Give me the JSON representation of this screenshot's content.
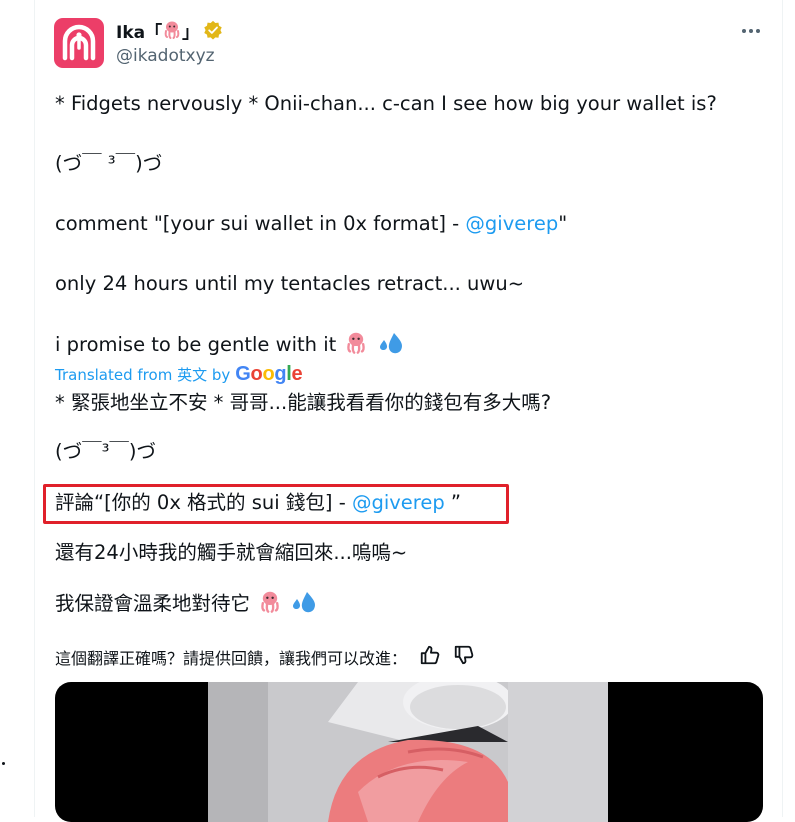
{
  "tweet": {
    "author": {
      "display_name": "Ika「",
      "display_name_suffix": "」",
      "handle": "@ikadotxyz",
      "verified": true,
      "avatar_color": "#ec3e68"
    },
    "more_label": "More",
    "original": {
      "line1": "* Fidgets nervously * Onii-chan... c-can I see how big your wallet is?",
      "line2": "(づ￣ ³￣)づ",
      "line3_pre": "comment \"[your sui wallet in 0x format] - ",
      "line3_mention": "@giverep",
      "line3_post": "\"",
      "line4": "only 24 hours until my tentacles retract... uwu~",
      "line5": "i promise to be gentle with it"
    },
    "translation_note": {
      "prefix": "Translated from 英文 by",
      "provider": "Google"
    },
    "translated": {
      "line1": "* 緊張地坐立不安 * 哥哥...能讓我看看你的錢包有多大嗎?",
      "line2": "(づ￣³￣)づ",
      "line3_pre": "評論“[你的 0x 格式的 sui 錢包] - ",
      "line3_mention": "@giverep",
      "line3_post": " ”",
      "line4": "還有24小時我的觸手就會縮回來...嗚嗚~",
      "line5": "我保證會溫柔地對待它"
    },
    "feedback": {
      "question": "這個翻譯正確嗎？請提供回饋，讓我們可以改進："
    }
  },
  "colors": {
    "link": "#1d9bf0",
    "secondary_text": "#536471",
    "highlight_border": "#e0202a"
  },
  "icons": [
    "octopus-emoji",
    "verified-badge-icon",
    "sweat-droplets-emoji",
    "thumbs-up-icon",
    "thumbs-down-icon",
    "more-icon"
  ]
}
